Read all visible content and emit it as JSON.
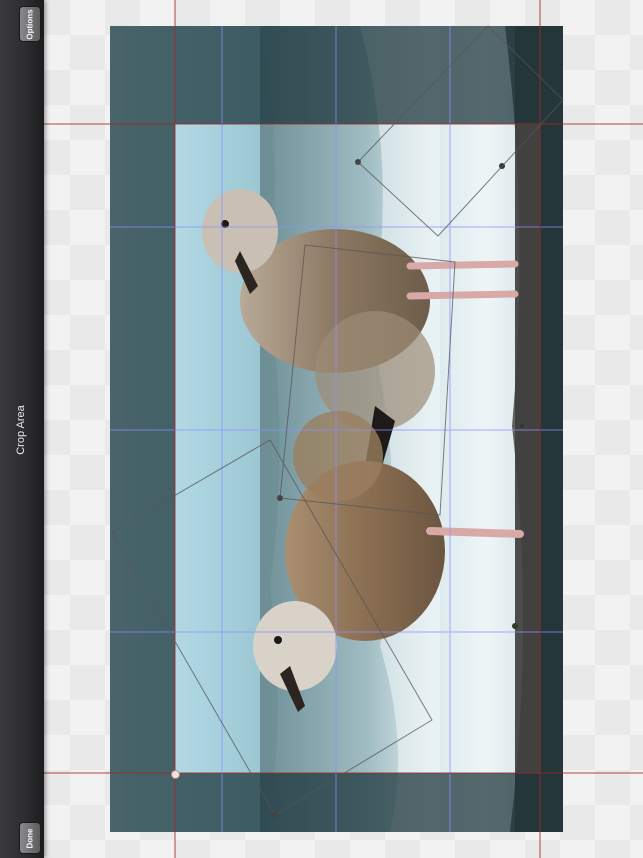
{
  "toolbar": {
    "options_label": "Options",
    "title": "Crop Area",
    "done_label": "Done"
  },
  "colors": {
    "toolbar_bg": "#2c2c2e",
    "grid_line": "#8f8fff",
    "crop_line": "#a02828",
    "sky": "#b9dde8",
    "sea": "#5b7a80"
  },
  "icons": {
    "crop_handle": "crop-corner-handle"
  }
}
